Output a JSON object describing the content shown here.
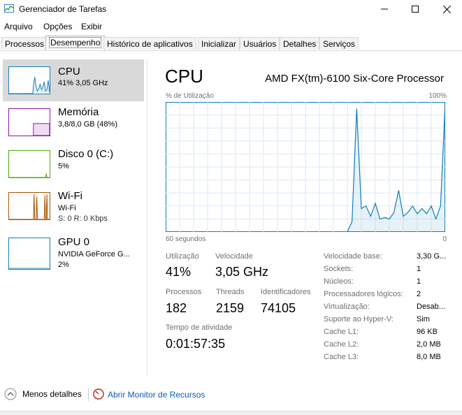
{
  "window": {
    "title": "Gerenciador de Tarefas",
    "controls": [
      "minimize-icon",
      "maximize-icon",
      "close-icon"
    ]
  },
  "menu": [
    "Arquivo",
    "Opções",
    "Exibir"
  ],
  "tabs": [
    {
      "label": "Processos",
      "active": false
    },
    {
      "label": "Desempenho",
      "active": true
    },
    {
      "label": "Histórico de aplicativos",
      "active": false
    },
    {
      "label": "Inicializar",
      "active": false
    },
    {
      "label": "Usuários",
      "active": false
    },
    {
      "label": "Detalhes",
      "active": false
    },
    {
      "label": "Serviços",
      "active": false
    }
  ],
  "sidebar": [
    {
      "name": "CPU",
      "line1": "41% 3,05 GHz",
      "line2": "",
      "color": "#117dbb",
      "active": true
    },
    {
      "name": "Memória",
      "line1": "3,8/8,0 GB (48%)",
      "line2": "",
      "color": "#8b12ae",
      "active": false
    },
    {
      "name": "Disco 0 (C:)",
      "line1": "5%",
      "line2": "",
      "color": "#4da60c",
      "active": false
    },
    {
      "name": "Wi-Fi",
      "line1": "Wi-Fi",
      "line2": "S: 0 R: 0 Kbps",
      "color": "#a74f01",
      "active": false
    },
    {
      "name": "GPU 0",
      "line1": "NVIDIA GeForce G...",
      "line2": "2%",
      "color": "#117dbb",
      "active": false
    }
  ],
  "main": {
    "title": "CPU",
    "processor": "AMD FX(tm)-6100 Six-Core Processor",
    "graph": {
      "ylabel": "% de Utilização",
      "ymax_label": "100%",
      "xlabel_left": "60 segundos",
      "xlabel_right": "0",
      "color": "#117dbb"
    },
    "stats": {
      "utilization_label": "Utilização",
      "utilization_value": "41%",
      "speed_label": "Velocidade",
      "speed_value": "3,05 GHz",
      "processes_label": "Processos",
      "processes_value": "182",
      "threads_label": "Threads",
      "threads_value": "2159",
      "handles_label": "Identificadores",
      "handles_value": "74105",
      "uptime_label": "Tempo de atividade",
      "uptime_value": "0:01:57:35"
    },
    "details": [
      {
        "label": "Velocidade base:",
        "value": "3,30 G..."
      },
      {
        "label": "Sockets:",
        "value": "1"
      },
      {
        "label": "Núcleos:",
        "value": "1"
      },
      {
        "label": "Processadores lógicos:",
        "value": "2"
      },
      {
        "label": "Virtualização:",
        "value": "Desab..."
      },
      {
        "label": "Suporte ao Hyper-V:",
        "value": "Sim"
      },
      {
        "label": "Cache L1:",
        "value": "96 KB"
      },
      {
        "label": "Cache L2:",
        "value": "2,0 MB"
      },
      {
        "label": "Cache L3:",
        "value": "8,0 MB"
      }
    ]
  },
  "footer": {
    "fewer_details": "Menos detalhes",
    "resource_monitor": "Abrir Monitor de Recursos"
  },
  "chart_data": {
    "type": "area",
    "x": [
      0,
      1,
      2,
      3,
      4,
      5,
      6,
      7,
      8,
      9,
      10,
      11,
      12,
      13,
      14,
      15,
      16,
      17,
      18,
      19,
      20,
      21,
      22,
      23,
      24,
      25,
      26,
      27,
      28,
      29,
      30,
      31,
      32,
      33,
      34,
      35,
      36,
      37,
      38,
      39,
      40,
      41,
      42,
      43,
      44,
      45,
      46,
      47,
      48,
      49,
      50,
      51,
      52,
      53,
      54,
      55,
      56,
      57,
      58,
      59,
      60
    ],
    "values": [
      0,
      0,
      0,
      0,
      0,
      0,
      0,
      0,
      0,
      0,
      0,
      0,
      0,
      0,
      0,
      0,
      0,
      0,
      0,
      0,
      0,
      0,
      0,
      0,
      0,
      0,
      0,
      0,
      0,
      0,
      0,
      0,
      0,
      0,
      0,
      0,
      0,
      0,
      0,
      0,
      8,
      95,
      18,
      20,
      12,
      22,
      10,
      11,
      10,
      15,
      32,
      12,
      15,
      20,
      14,
      18,
      14,
      20,
      10,
      20,
      100
    ],
    "xlabel": "60 segundos",
    "ylim": [
      0,
      100
    ],
    "grid": true
  }
}
